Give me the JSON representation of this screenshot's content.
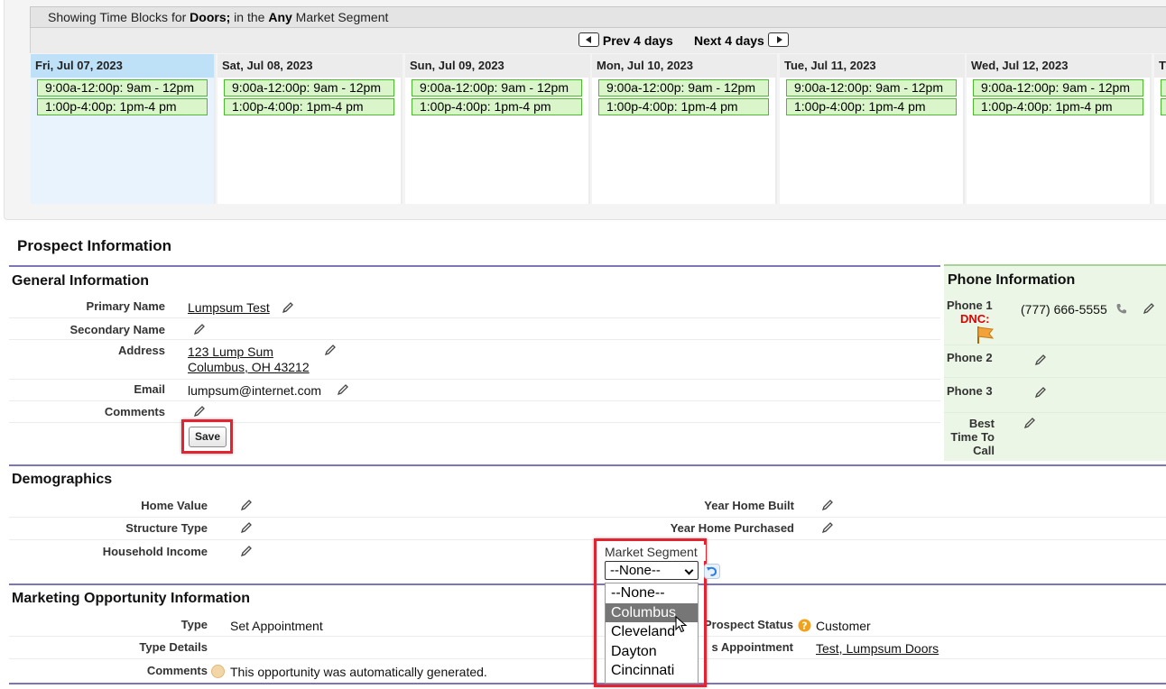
{
  "calendar": {
    "header_prefix": "Showing Time Blocks for ",
    "header_category": "Doors;",
    "header_mid": " in the ",
    "header_segment": "Any",
    "header_suffix": " Market Segment",
    "prev_label": "Prev 4 days",
    "next_label": "Next 4 days",
    "days": [
      {
        "label": "Fri, Jul 07, 2023",
        "slots": [
          "9:00a-12:00p: 9am - 12pm",
          "1:00p-4:00p: 1pm-4 pm"
        ]
      },
      {
        "label": "Sat, Jul 08, 2023",
        "slots": [
          "9:00a-12:00p: 9am - 12pm",
          "1:00p-4:00p: 1pm-4 pm"
        ]
      },
      {
        "label": "Sun, Jul 09, 2023",
        "slots": [
          "9:00a-12:00p: 9am - 12pm",
          "1:00p-4:00p: 1pm-4 pm"
        ]
      },
      {
        "label": "Mon, Jul 10, 2023",
        "slots": [
          "9:00a-12:00p: 9am - 12pm",
          "1:00p-4:00p: 1pm-4 pm"
        ]
      },
      {
        "label": "Tue, Jul 11, 2023",
        "slots": [
          "9:00a-12:00p: 9am - 12pm",
          "1:00p-4:00p: 1pm-4 pm"
        ]
      },
      {
        "label": "Wed, Jul 12, 2023",
        "slots": [
          "9:00a-12:00p: 9am - 12pm",
          "1:00p-4:00p: 1pm-4 pm"
        ]
      },
      {
        "label": "T",
        "slots": [
          "",
          ""
        ]
      }
    ]
  },
  "prospect": {
    "title": "Prospect Information",
    "general": {
      "title": "General Information",
      "primary_name_label": "Primary Name",
      "primary_name": "Lumpsum Test",
      "secondary_name_label": "Secondary Name",
      "address_label": "Address",
      "address_line1": "123 Lump Sum",
      "address_line2": "Columbus, OH 43212",
      "email_label": "Email",
      "email": "lumpsum@internet.com",
      "comments_label": "Comments",
      "save_label": "Save"
    },
    "phone": {
      "title": "Phone Information",
      "phone1_label": "Phone 1",
      "dnc_label": "DNC:",
      "phone1": "(777) 666-5555",
      "phone2_label": "Phone 2",
      "phone3_label": "Phone 3",
      "best_time_label_1": "Best",
      "best_time_label_2": "Time To",
      "best_time_label_3": "Call"
    },
    "demographics": {
      "title": "Demographics",
      "home_value_label": "Home Value",
      "structure_type_label": "Structure Type",
      "household_income_label": "Household Income",
      "year_built_label": "Year Home Built",
      "year_purchased_label": "Year Home Purchased",
      "market_segment_label": "Market Segment",
      "market_segment_selected": "--None--",
      "market_segment_options": [
        "--None--",
        "Columbus",
        "Cleveland",
        "Dayton",
        "Cincinnati"
      ],
      "highlighted_option": "Columbus"
    },
    "marketing": {
      "title": "Marketing Opportunity Information",
      "type_label": "Type",
      "type_value": "Set Appointment",
      "type_details_label": "Type Details",
      "comments_label": "Comments",
      "comments_value": "This opportunity was automatically generated.",
      "prospect_status_label": "Prospect Status",
      "prospect_status_value": "Customer",
      "appointment_label": "s Appointment",
      "appointment_value": "Test, Lumpsum Doors"
    }
  },
  "colors": {
    "section_line": "#7c76b6",
    "slot_border": "#4cbb2e",
    "slot_bg": "#d9f5c9",
    "today_head": "#bfe1f7",
    "highlight": "#e3232f",
    "phone_bg": "#ebf6e6",
    "dnc": "#e00000"
  }
}
